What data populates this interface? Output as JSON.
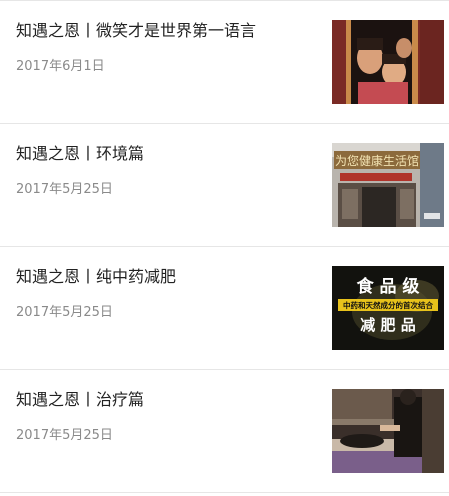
{
  "articles": [
    {
      "title": "知遇之恩丨微笑才是世界第一语言",
      "date": "2017年6月1日",
      "thumbnail": "children-smiling-in-doorway"
    },
    {
      "title": "知遇之恩丨环境篇",
      "date": "2017年5月25日",
      "thumbnail": "storefront",
      "thumb_text": {
        "sign": "为您健康生活馆"
      }
    },
    {
      "title": "知遇之恩丨纯中药减肥",
      "date": "2017年5月25日",
      "thumbnail": "product-banner",
      "thumb_text": {
        "line1": "食 品 级",
        "line2": "中药和天然成分的首次结合",
        "line3": "减 肥 品"
      }
    },
    {
      "title": "知遇之恩丨治疗篇",
      "date": "2017年5月25日",
      "thumbnail": "treatment-room"
    }
  ],
  "colors": {
    "title": "#222222",
    "date": "#8a8a8a",
    "divider": "#e6e6e6",
    "background": "#ffffff"
  }
}
